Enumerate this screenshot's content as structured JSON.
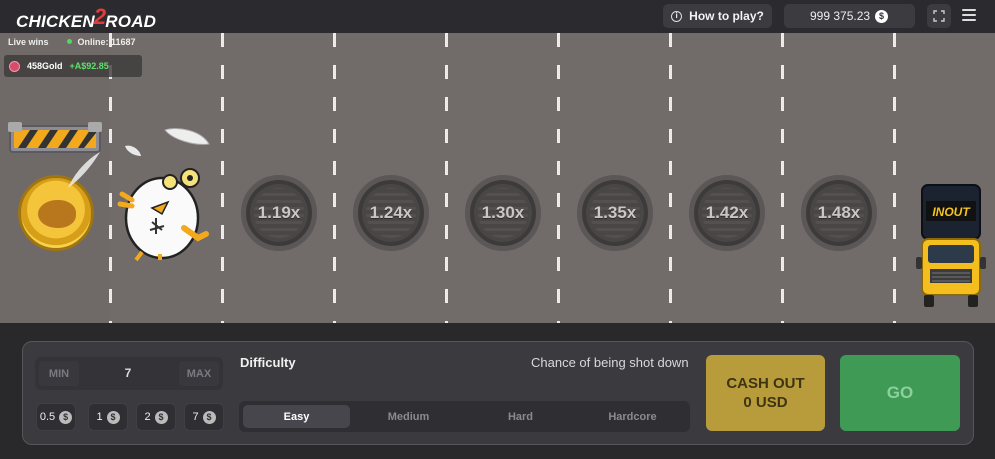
{
  "header": {
    "logo_left": "CHICKEN",
    "logo_num": "2",
    "logo_right": "ROAD",
    "how_to_play": "How to play?",
    "info_icon": "info-icon",
    "balance": "999 375.23",
    "currency_glyph": "$",
    "expand_icon": "expand-icon",
    "menu_icon": "menu-icon"
  },
  "live": {
    "label": "Live wins",
    "online": "Online: 11687",
    "winner_name": "458Gold",
    "winner_amount": "+A$92.85"
  },
  "road": {
    "multipliers": [
      "1.19x",
      "1.24x",
      "1.30x",
      "1.35x",
      "1.42x",
      "1.48x"
    ],
    "truck_brand": "INOUT"
  },
  "controls": {
    "min_label": "MIN",
    "bet_value": "7",
    "max_label": "MAX",
    "quick_bets": [
      "0.5",
      "1",
      "2",
      "7"
    ],
    "coin_glyph": "$",
    "difficulty_label": "Difficulty",
    "chance_label": "Chance of being shot down",
    "difficulties": [
      "Easy",
      "Medium",
      "Hard",
      "Hardcore"
    ],
    "active_difficulty": "Easy",
    "cashout_line1": "CASH OUT",
    "cashout_line2": "0 USD",
    "go_label": "GO"
  },
  "colors": {
    "road": "#716b69",
    "panel": "#3a3a3f",
    "cashout": "#b89c3c",
    "go": "#3e9a55",
    "win_green": "#5be36b"
  }
}
